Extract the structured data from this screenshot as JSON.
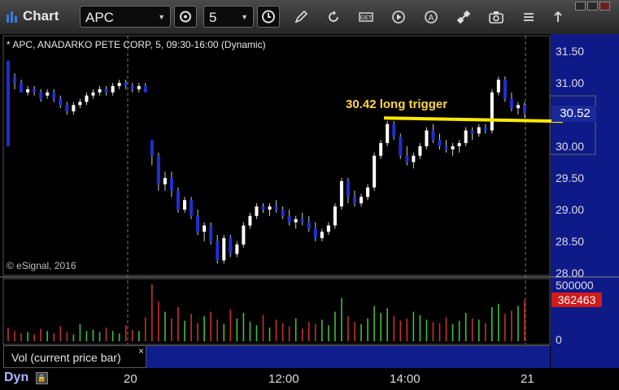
{
  "app": {
    "title": "Chart"
  },
  "toolbar": {
    "symbol": "APC",
    "interval": "5",
    "icons": [
      "clock-settings-icon",
      "pencil-icon",
      "refresh-icon",
      "get-icon",
      "play-icon",
      "alert-icon",
      "connect-icon",
      "camera-icon",
      "menu-icon",
      "link-icon"
    ]
  },
  "chart": {
    "info": "* APC, ANADARKO PETE CORP, 5, 09:30-16:00 (Dynamic)",
    "copyright": "© eSignal, 2016",
    "annotation": "30.42 long trigger",
    "last_price": "30.52",
    "price_ticks": [
      "31.50",
      "31.00",
      "30.50",
      "30.00",
      "29.50",
      "29.00",
      "28.50",
      "28.00"
    ],
    "colors": {
      "up": "#ffffff",
      "down": "#1f2fd0",
      "trigger": "#ffea00",
      "annotation": "#ffd54a"
    }
  },
  "volume": {
    "label": "Vol (current price bar)",
    "close": "×",
    "axis_top": "500000",
    "axis_bottom": "0",
    "last": "362463"
  },
  "footer": {
    "mode": "Dyn",
    "time_labels": [
      "20",
      "12:00",
      "14:00",
      "21"
    ]
  },
  "chart_data": {
    "type": "candlestick",
    "ylim": [
      28.0,
      31.6
    ],
    "trigger_level": 30.42,
    "candles": [
      [
        31.35,
        31.3,
        31.1,
        30.0
      ],
      [
        31.1,
        31.15,
        30.9,
        31.0
      ],
      [
        31.0,
        31.05,
        30.85,
        30.85
      ],
      [
        30.85,
        30.95,
        30.8,
        30.9
      ],
      [
        30.9,
        30.95,
        30.8,
        30.85
      ],
      [
        30.85,
        30.9,
        30.7,
        30.75
      ],
      [
        30.8,
        30.9,
        30.75,
        30.85
      ],
      [
        30.85,
        30.9,
        30.7,
        30.75
      ],
      [
        30.75,
        30.8,
        30.6,
        30.65
      ],
      [
        30.65,
        30.7,
        30.5,
        30.55
      ],
      [
        30.55,
        30.7,
        30.5,
        30.65
      ],
      [
        30.65,
        30.75,
        30.6,
        30.7
      ],
      [
        30.7,
        30.85,
        30.65,
        30.8
      ],
      [
        30.8,
        30.9,
        30.75,
        30.85
      ],
      [
        30.85,
        30.95,
        30.8,
        30.9
      ],
      [
        30.9,
        30.95,
        30.8,
        30.85
      ],
      [
        30.85,
        31.0,
        30.8,
        30.95
      ],
      [
        30.95,
        31.05,
        30.9,
        31.0
      ],
      [
        31.0,
        31.05,
        30.9,
        30.95
      ],
      [
        30.95,
        31.0,
        30.85,
        30.9
      ],
      [
        30.9,
        31.0,
        30.85,
        30.95
      ],
      [
        30.95,
        31.0,
        30.85,
        30.85
      ],
      [
        30.1,
        30.0,
        29.7,
        29.85
      ],
      [
        29.85,
        29.9,
        29.3,
        29.4
      ],
      [
        29.4,
        29.6,
        29.3,
        29.5
      ],
      [
        29.5,
        29.6,
        29.2,
        29.3
      ],
      [
        29.3,
        29.35,
        28.95,
        29.0
      ],
      [
        29.0,
        29.2,
        28.95,
        29.15
      ],
      [
        29.15,
        29.2,
        28.85,
        28.9
      ],
      [
        28.9,
        29.0,
        28.6,
        28.65
      ],
      [
        28.65,
        28.8,
        28.5,
        28.75
      ],
      [
        28.75,
        28.8,
        28.45,
        28.5
      ],
      [
        28.5,
        28.6,
        28.15,
        28.2
      ],
      [
        28.2,
        28.6,
        28.15,
        28.55
      ],
      [
        28.55,
        28.6,
        28.25,
        28.3
      ],
      [
        28.3,
        28.5,
        28.25,
        28.45
      ],
      [
        28.45,
        28.8,
        28.4,
        28.75
      ],
      [
        28.75,
        28.95,
        28.7,
        28.9
      ],
      [
        28.9,
        29.1,
        28.85,
        29.05
      ],
      [
        29.05,
        29.1,
        28.95,
        29.0
      ],
      [
        29.0,
        29.1,
        28.9,
        29.05
      ],
      [
        29.05,
        29.15,
        28.95,
        29.0
      ],
      [
        29.0,
        29.05,
        28.85,
        28.9
      ],
      [
        28.9,
        29.0,
        28.75,
        28.8
      ],
      [
        28.8,
        28.9,
        28.7,
        28.85
      ],
      [
        28.85,
        28.95,
        28.75,
        28.8
      ],
      [
        28.8,
        28.9,
        28.65,
        28.7
      ],
      [
        28.7,
        28.8,
        28.5,
        28.55
      ],
      [
        28.55,
        28.7,
        28.5,
        28.65
      ],
      [
        28.65,
        28.8,
        28.6,
        28.75
      ],
      [
        28.75,
        29.1,
        28.7,
        29.05
      ],
      [
        29.05,
        29.5,
        29.0,
        29.45
      ],
      [
        29.45,
        29.5,
        29.1,
        29.2
      ],
      [
        29.2,
        29.3,
        29.05,
        29.1
      ],
      [
        29.1,
        29.25,
        29.05,
        29.2
      ],
      [
        29.2,
        29.4,
        29.15,
        29.35
      ],
      [
        29.35,
        29.9,
        29.3,
        29.85
      ],
      [
        29.85,
        30.1,
        29.8,
        30.05
      ],
      [
        30.05,
        30.4,
        30.0,
        30.35
      ],
      [
        30.35,
        30.4,
        30.1,
        30.15
      ],
      [
        30.15,
        30.2,
        29.8,
        29.85
      ],
      [
        29.85,
        30.0,
        29.7,
        29.75
      ],
      [
        29.75,
        29.9,
        29.65,
        29.85
      ],
      [
        29.85,
        30.05,
        29.8,
        30.0
      ],
      [
        30.0,
        30.3,
        29.95,
        30.25
      ],
      [
        30.25,
        30.35,
        30.05,
        30.1
      ],
      [
        30.1,
        30.2,
        29.95,
        30.0
      ],
      [
        30.0,
        30.1,
        29.9,
        29.95
      ],
      [
        29.95,
        30.05,
        29.85,
        30.0
      ],
      [
        30.0,
        30.1,
        29.9,
        30.05
      ],
      [
        30.05,
        30.3,
        30.0,
        30.25
      ],
      [
        30.25,
        30.3,
        30.1,
        30.2
      ],
      [
        30.2,
        30.35,
        30.15,
        30.3
      ],
      [
        30.3,
        30.35,
        30.2,
        30.25
      ],
      [
        30.25,
        30.9,
        30.2,
        30.85
      ],
      [
        30.85,
        31.1,
        30.8,
        31.05
      ],
      [
        31.05,
        31.1,
        30.7,
        30.75
      ],
      [
        30.75,
        30.85,
        30.55,
        30.6
      ],
      [
        30.6,
        30.7,
        30.5,
        30.65
      ],
      [
        30.65,
        30.7,
        30.45,
        30.52
      ]
    ],
    "volume_ylim": [
      0,
      500000
    ],
    "volumes": [
      120000,
      90000,
      70000,
      80000,
      60000,
      110000,
      90000,
      70000,
      130000,
      80000,
      60000,
      150000,
      90000,
      100000,
      80000,
      120000,
      90000,
      70000,
      140000,
      100000,
      90000,
      210000,
      500000,
      350000,
      260000,
      200000,
      300000,
      180000,
      240000,
      160000,
      220000,
      260000,
      190000,
      150000,
      280000,
      200000,
      250000,
      170000,
      140000,
      230000,
      120000,
      190000,
      160000,
      130000,
      200000,
      110000,
      170000,
      150000,
      190000,
      140000,
      260000,
      380000,
      220000,
      170000,
      150000,
      200000,
      310000,
      250000,
      290000,
      220000,
      180000,
      200000,
      260000,
      230000,
      190000,
      170000,
      160000,
      210000,
      150000,
      180000,
      250000,
      200000,
      190000,
      160000,
      300000,
      330000,
      240000,
      270000,
      310000,
      362463
    ]
  }
}
